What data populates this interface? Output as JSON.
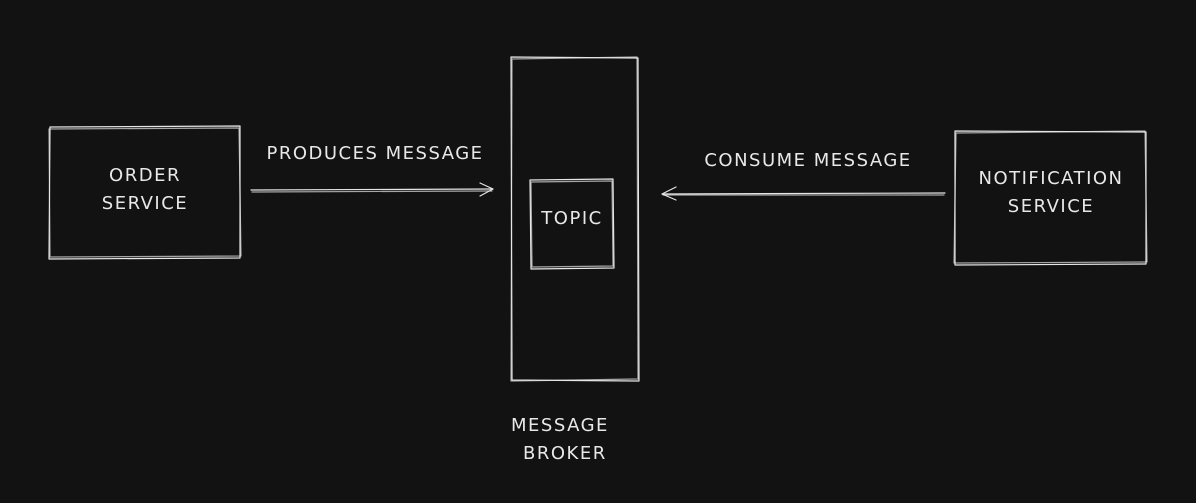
{
  "diagram": {
    "order_service": {
      "line1": "ORDER",
      "line2": "SERVICE"
    },
    "produces_label": "PRODUCES MESSAGE",
    "topic_label": "TOPIC",
    "consume_label": "CONSUME MESSAGE",
    "notification_service": {
      "line1": "NOTIFICATION",
      "line2": "SERVICE"
    },
    "broker_caption": {
      "line1": "MESSAGE",
      "line2": "BROKER"
    }
  },
  "colors": {
    "background": "#121212",
    "stroke": "#e6e6e6",
    "text": "#e8e8e8"
  }
}
